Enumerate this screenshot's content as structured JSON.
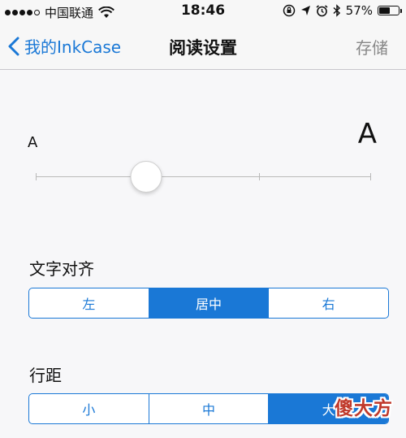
{
  "status_bar": {
    "carrier": "中国联通",
    "time": "18:46",
    "battery_percent": "57%",
    "battery_level": 0.57,
    "icons": [
      "signal-dots",
      "wifi-icon",
      "rotation-lock-icon",
      "location-icon",
      "alarm-icon",
      "bluetooth-icon",
      "battery-icon"
    ]
  },
  "nav": {
    "back_label": "我的InkCase",
    "title": "阅读设置",
    "save_label": "存储"
  },
  "font_size": {
    "small_label": "A",
    "large_label": "A",
    "slider_value": 0.33,
    "slider_steps": 4
  },
  "text_align": {
    "label": "文字对齐",
    "options": [
      "左",
      "居中",
      "右"
    ],
    "selected": "居中"
  },
  "line_spacing": {
    "label": "行距",
    "options": [
      "小",
      "中",
      "大"
    ],
    "selected": "大"
  },
  "watermark": "傻大方",
  "colors": {
    "accent": "#1a78d6",
    "nav_disabled": "#888888",
    "watermark": "#c0392b"
  }
}
